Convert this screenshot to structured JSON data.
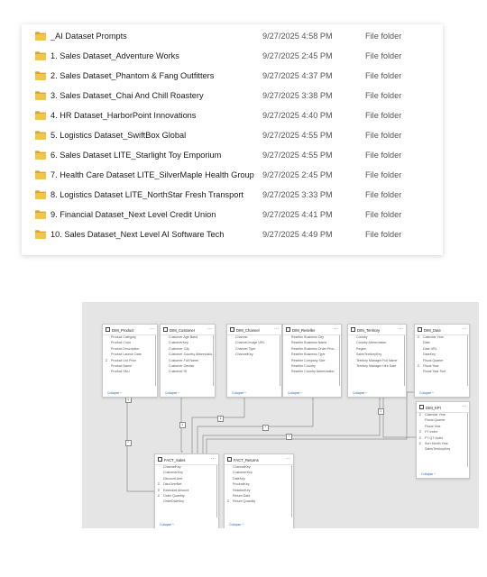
{
  "explorer": {
    "rows": [
      {
        "name": "_AI Dataset Prompts",
        "date": "9/27/2025 4:58 PM",
        "type": "File folder"
      },
      {
        "name": "1. Sales Dataset_Adventure Works",
        "date": "9/27/2025 2:45 PM",
        "type": "File folder"
      },
      {
        "name": "2. Sales Dataset_Phantom & Fang Outfitters",
        "date": "9/27/2025 4:37 PM",
        "type": "File folder"
      },
      {
        "name": "3. Sales Dataset_Chai And Chill Roastery",
        "date": "9/27/2025 3:38 PM",
        "type": "File folder"
      },
      {
        "name": "4. HR Dataset_HarborPoint Innovations",
        "date": "9/27/2025 4:40 PM",
        "type": "File folder"
      },
      {
        "name": "5. Logistics Dataset_SwiftBox Global",
        "date": "9/27/2025 4:55 PM",
        "type": "File folder"
      },
      {
        "name": "6. Sales Dataset LITE_Starlight Toy Emporium",
        "date": "9/27/2025 4:55 PM",
        "type": "File folder"
      },
      {
        "name": "7. Health Care Dataset LITE_SilverMaple Health Group",
        "date": "9/27/2025 2:45 PM",
        "type": "File folder"
      },
      {
        "name": "8. Logistics Dataset LITE_NorthStar Fresh Transport",
        "date": "9/27/2025 3:33 PM",
        "type": "File folder"
      },
      {
        "name": "9. Financial Dataset_Next Level Credit Union",
        "date": "9/27/2025 4:41 PM",
        "type": "File folder"
      },
      {
        "name": "10. Sales Dataset_Next Level AI Software Tech",
        "date": "9/27/2025 4:49 PM",
        "type": "File folder"
      }
    ],
    "folder_icon": "folder-icon",
    "folder_color": "#e8b73d"
  },
  "model": {
    "collapse_label": "Collapse ^",
    "tables": [
      {
        "name": "DIM_Product",
        "fields": [
          "Product Category",
          "Product Color",
          "Product Description",
          "Product Launch Date",
          "Product List Price",
          "Product Name",
          "Product SKU"
        ],
        "sigma": [
          false,
          false,
          false,
          false,
          true,
          false,
          false
        ]
      },
      {
        "name": "DIM_Customer",
        "fields": [
          "Customer Age Band",
          "CustomerKey",
          "Customer City",
          "Customer Country Abbreviatio...",
          "Customer Full Name",
          "Customer Gender",
          "Customer ID"
        ],
        "sigma": [
          false,
          false,
          false,
          false,
          false,
          false,
          false
        ]
      },
      {
        "name": "DIM_Channel",
        "fields": [
          "Channel",
          "Channel Image URL",
          "Channel Type",
          "ChannelKey"
        ],
        "sigma": [
          false,
          false,
          false,
          false
        ]
      },
      {
        "name": "DIM_Reseller",
        "fields": [
          "Reseller Business City",
          "Reseller Business Name",
          "Reseller Business Order Proc...",
          "Reseller Business Type",
          "Reseller Company Size",
          "Reseller Country",
          "Reseller Country Abbreviation"
        ],
        "sigma": [
          false,
          false,
          false,
          false,
          false,
          false,
          false
        ]
      },
      {
        "name": "DIM_Territory",
        "fields": [
          "Country",
          "Country Abbreviation",
          "Region",
          "SalesTerritoryKey",
          "Territory Manager Full Name",
          "Territory Manager Hire Date"
        ],
        "sigma": [
          false,
          false,
          false,
          false,
          false,
          false
        ]
      },
      {
        "name": "DIM_Date",
        "fields": [
          "Calendar Year",
          "Date",
          "Date URL",
          "DateKey",
          "Fiscal Quarter",
          "Fiscal Year",
          "Fiscal Year Sort"
        ],
        "sigma": [
          true,
          false,
          false,
          false,
          false,
          true,
          false
        ]
      },
      {
        "name": "DIM_KPI",
        "fields": [
          "Calendar Year",
          "Fiscal Quarter",
          "Fiscal Year",
          "FY Index",
          "FY QT Index",
          "Sort Month Year",
          "SalesTerritoryKey"
        ],
        "sigma": [
          true,
          false,
          false,
          true,
          true,
          true,
          false
        ]
      },
      {
        "name": "FACT_Sales",
        "fields": [
          "ChannelKey",
          "CustomerKey",
          "Discount Amt",
          "DiscOverNet",
          "Extended Amount",
          "Order Quantity",
          "OrderDateKey"
        ],
        "sigma": [
          false,
          false,
          false,
          true,
          true,
          true,
          false
        ]
      },
      {
        "name": "FACT_Returns",
        "fields": [
          "ChannelKey",
          "CustomerKey",
          "DateKey",
          "ProductKey",
          "ResellerKey",
          "Return Date",
          "Return Quantity"
        ],
        "sigma": [
          false,
          false,
          false,
          false,
          false,
          false,
          true
        ]
      }
    ],
    "rel_labels": [
      "1",
      "1",
      "1",
      "1",
      "*",
      "*",
      "*"
    ]
  }
}
